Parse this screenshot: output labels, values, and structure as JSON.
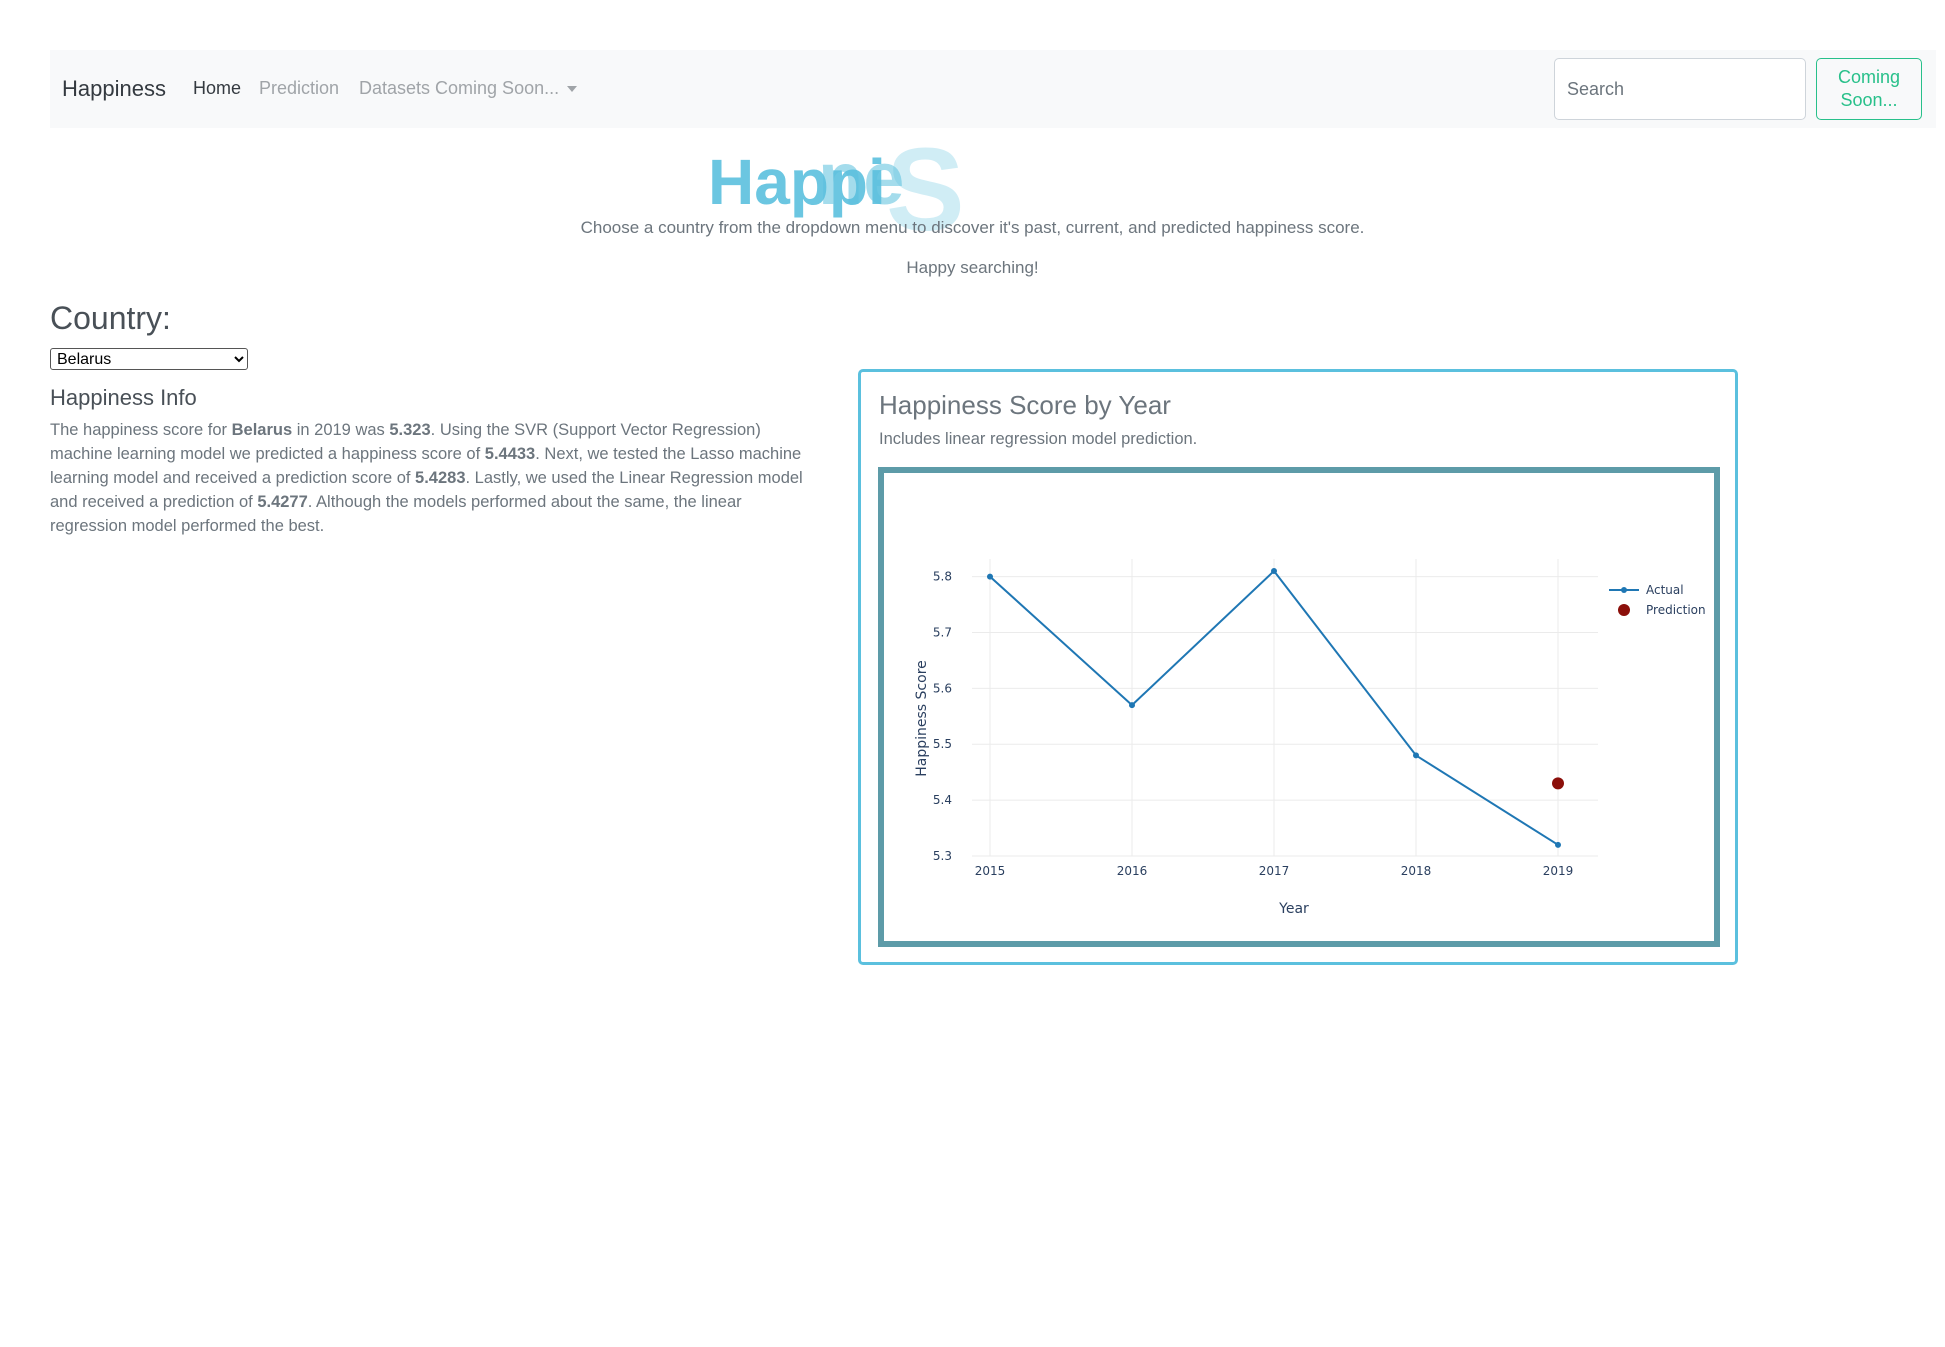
{
  "navbar": {
    "brand": "Happiness",
    "links": [
      {
        "label": "Home"
      },
      {
        "label": "Prediction"
      },
      {
        "label": "Datasets Coming Soon..."
      }
    ],
    "search_placeholder": "Search",
    "coming_soon_button": "Coming Soon..."
  },
  "logo": {
    "text": "Happiness"
  },
  "intro": {
    "line1": "Choose a country from the dropdown menu to discover it's past, current, and predicted happiness score.",
    "line2": "Happy searching!"
  },
  "country": {
    "label": "Country:",
    "selected": "Belarus"
  },
  "happiness_info": {
    "title": "Happiness Info",
    "t1": "The happiness score for ",
    "country": "Belarus",
    "t2": " in 2019 was ",
    "actual_score": "5.323",
    "t3": ". Using the SVR (Support Vector Regression) machine learning model we predicted a happiness score of ",
    "svr_score": "5.4433",
    "t4": ". Next, we tested the Lasso machine learning model and received a prediction score of ",
    "lasso_score": "5.4283",
    "t5": ". Lastly, we used the Linear Regression model and received a prediction of ",
    "linear_score": "5.4277",
    "t6": ". Although the models performed about the same, the linear regression model performed the best."
  },
  "chart_card": {
    "title": "Happiness Score by Year",
    "subtitle": "Includes linear regression model prediction."
  },
  "colors": {
    "actual": "#1f77b4",
    "prediction": "#8b0f0a",
    "card_border": "#5bc0de",
    "plot_frame": "#5d9ba8",
    "accent_green": "#28c08a"
  },
  "chart_data": {
    "type": "line",
    "xlabel": "Year",
    "ylabel": "Happiness Score",
    "x": [
      2015,
      2016,
      2017,
      2018,
      2019
    ],
    "y_ticks": [
      5.3,
      5.4,
      5.5,
      5.6,
      5.7,
      5.8
    ],
    "ylim": [
      5.3,
      5.81
    ],
    "grid": true,
    "legend_position": "top-right",
    "series": [
      {
        "name": "Actual",
        "mode": "lines+markers",
        "x": [
          2015,
          2016,
          2017,
          2018,
          2019
        ],
        "values": [
          5.8,
          5.57,
          5.81,
          5.48,
          5.32
        ]
      },
      {
        "name": "Prediction",
        "mode": "markers",
        "x": [
          2019
        ],
        "values": [
          5.43
        ]
      }
    ]
  }
}
